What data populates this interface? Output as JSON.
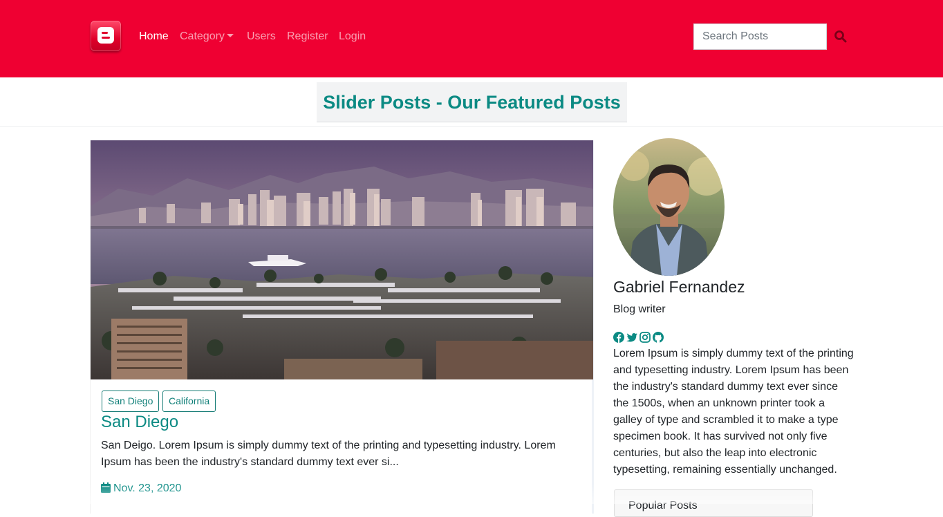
{
  "navbar": {
    "logo_icon": "blogger-logo-icon",
    "links": [
      "Home",
      "Category",
      "Users",
      "Register",
      "Login"
    ],
    "active": "Home",
    "search": {
      "placeholder": "Search Posts",
      "value": ""
    },
    "search_icon": "search-icon",
    "brand_color": "#ef0032"
  },
  "section": {
    "heading": "Slider Posts - Our Featured Posts",
    "accent_color": "#0b8a83"
  },
  "post": {
    "tags": [
      "San Diego",
      "California"
    ],
    "title": "San Diego",
    "excerpt": "San Deigo. Lorem Ipsum is simply dummy text of the printing and typesetting industry. Lorem Ipsum has been the industry's standard dummy text ever si...",
    "date": "Nov. 23, 2020",
    "date_icon": "calendar-icon"
  },
  "author": {
    "name": "Gabriel Fernandez",
    "role": "Blog writer",
    "social_icons": [
      "facebook-icon",
      "twitter-icon",
      "instagram-icon",
      "github-icon"
    ],
    "bio": "Lorem Ipsum is simply dummy text of the printing and typesetting industry. Lorem Ipsum has been the industry's standard dummy text ever since the 1500s, when an unknown printer took a galley of type and scrambled it to make a type specimen book. It has survived not only five centuries, but also the leap into electronic typesetting, remaining essentially unchanged."
  },
  "sidebar": {
    "popular_title": "Popular Posts"
  }
}
